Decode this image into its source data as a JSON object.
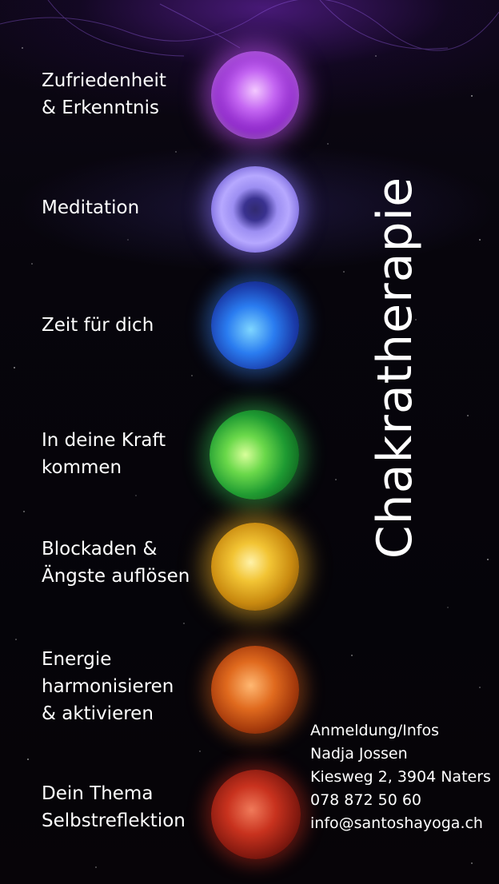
{
  "title": "Chakratherapie",
  "chakras": [
    {
      "lines": [
        "Zufriedenheit",
        "& Erkenntnis"
      ],
      "orb_icon": "violet-crown-orb",
      "color": "#b455e8"
    },
    {
      "lines": [
        "Meditation"
      ],
      "orb_icon": "indigo-eye-orb",
      "color": "#9a8cf0"
    },
    {
      "lines": [
        "Zeit für dich"
      ],
      "orb_icon": "blue-throat-orb",
      "color": "#2a7cf0"
    },
    {
      "lines": [
        "In deine Kraft",
        "kommen"
      ],
      "orb_icon": "green-heart-orb",
      "color": "#3cc048"
    },
    {
      "lines": [
        "Blockaden &",
        "Ängste auflösen"
      ],
      "orb_icon": "yellow-solar-orb",
      "color": "#f2c434"
    },
    {
      "lines": [
        "Energie",
        "harmonisieren",
        "& aktivieren"
      ],
      "orb_icon": "orange-sacral-orb",
      "color": "#e06a1e"
    },
    {
      "lines": [
        "Dein Thema",
        "Selbstreflektion"
      ],
      "orb_icon": "red-root-orb",
      "color": "#c8321e"
    }
  ],
  "contact": {
    "heading": "Anmeldung/Infos",
    "name": "Nadja Jossen",
    "address": "Kiesweg 2, 3904 Naters",
    "phone": "078 872  50 60",
    "email": "info@santoshayoga.ch"
  },
  "colors": {
    "background": "#050308",
    "text": "#ffffff"
  }
}
